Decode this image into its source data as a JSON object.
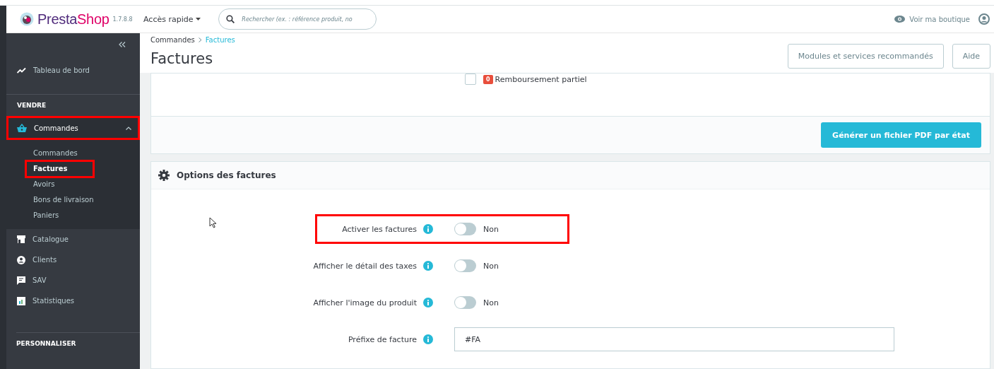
{
  "topbar": {
    "logo_parts": [
      "Presta",
      "Shop"
    ],
    "version": "1.7.8.8",
    "quick_access": "Accès rapide",
    "search": {
      "placeholder": "Rechercher (ex. : référence produit, no"
    },
    "view_shop": "Voir ma boutique"
  },
  "sidebar": {
    "items": [
      {
        "kind": "link",
        "label": "Tableau de bord"
      },
      {
        "kind": "section",
        "label": "VENDRE"
      },
      {
        "kind": "group",
        "label": "Commandes",
        "expanded": true,
        "highlighted": true,
        "children": [
          {
            "label": "Commandes",
            "selected": false,
            "highlighted": false
          },
          {
            "label": "Factures",
            "selected": true,
            "highlighted": true
          },
          {
            "label": "Avoirs",
            "selected": false,
            "highlighted": false
          },
          {
            "label": "Bons de livraison",
            "selected": false,
            "highlighted": false
          },
          {
            "label": "Paniers",
            "selected": false,
            "highlighted": false
          }
        ]
      },
      {
        "kind": "link",
        "label": "Catalogue"
      },
      {
        "kind": "link",
        "label": "Clients"
      },
      {
        "kind": "link",
        "label": "SAV"
      },
      {
        "kind": "link",
        "label": "Statistiques"
      },
      {
        "kind": "section",
        "label": "PERSONNALISER"
      }
    ]
  },
  "breadcrumb": [
    {
      "label": "Commandes",
      "selected": false
    },
    {
      "label": "Factures",
      "selected": true
    }
  ],
  "title": "Factures",
  "header_buttons": [
    "Modules et services recommandés",
    "Aide"
  ],
  "status_panel": {
    "checkbox": {
      "checked": false,
      "badge": "0",
      "label": "Remboursement partiel",
      "color": "#e84e3c"
    },
    "button": "Générer un fichier PDF par état"
  },
  "options_panel": {
    "title": "Options des factures",
    "rows": [
      {
        "kind": "toggle",
        "label": "Activer les factures",
        "on": false,
        "value": "Non",
        "highlighted": true
      },
      {
        "kind": "toggle",
        "label": "Afficher le détail des taxes",
        "on": false,
        "value": "Non",
        "highlighted": false
      },
      {
        "kind": "toggle",
        "label": "Afficher l'image du produit",
        "on": false,
        "value": "Non",
        "highlighted": false
      },
      {
        "kind": "text",
        "label": "Préfixe de facture",
        "value": "#FA",
        "highlighted": false
      }
    ]
  }
}
